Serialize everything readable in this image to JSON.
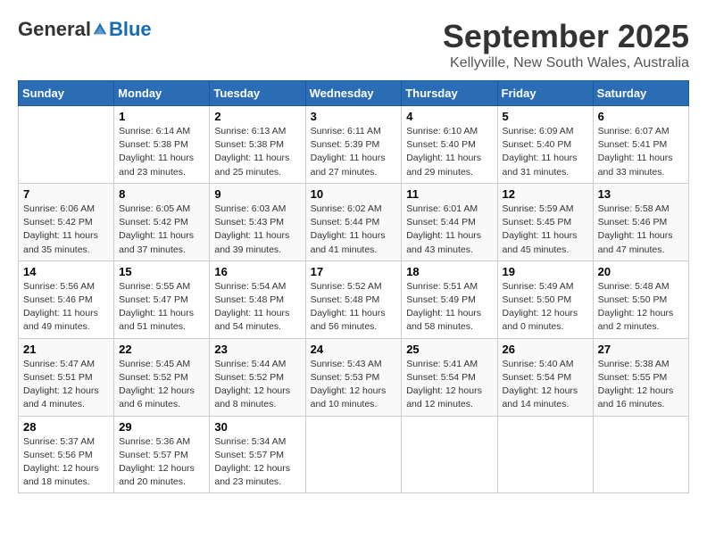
{
  "header": {
    "logo_general": "General",
    "logo_blue": "Blue",
    "month_title": "September 2025",
    "location": "Kellyville, New South Wales, Australia"
  },
  "days_of_week": [
    "Sunday",
    "Monday",
    "Tuesday",
    "Wednesday",
    "Thursday",
    "Friday",
    "Saturday"
  ],
  "weeks": [
    [
      {
        "day": "",
        "info": ""
      },
      {
        "day": "1",
        "info": "Sunrise: 6:14 AM\nSunset: 5:38 PM\nDaylight: 11 hours\nand 23 minutes."
      },
      {
        "day": "2",
        "info": "Sunrise: 6:13 AM\nSunset: 5:38 PM\nDaylight: 11 hours\nand 25 minutes."
      },
      {
        "day": "3",
        "info": "Sunrise: 6:11 AM\nSunset: 5:39 PM\nDaylight: 11 hours\nand 27 minutes."
      },
      {
        "day": "4",
        "info": "Sunrise: 6:10 AM\nSunset: 5:40 PM\nDaylight: 11 hours\nand 29 minutes."
      },
      {
        "day": "5",
        "info": "Sunrise: 6:09 AM\nSunset: 5:40 PM\nDaylight: 11 hours\nand 31 minutes."
      },
      {
        "day": "6",
        "info": "Sunrise: 6:07 AM\nSunset: 5:41 PM\nDaylight: 11 hours\nand 33 minutes."
      }
    ],
    [
      {
        "day": "7",
        "info": "Sunrise: 6:06 AM\nSunset: 5:42 PM\nDaylight: 11 hours\nand 35 minutes."
      },
      {
        "day": "8",
        "info": "Sunrise: 6:05 AM\nSunset: 5:42 PM\nDaylight: 11 hours\nand 37 minutes."
      },
      {
        "day": "9",
        "info": "Sunrise: 6:03 AM\nSunset: 5:43 PM\nDaylight: 11 hours\nand 39 minutes."
      },
      {
        "day": "10",
        "info": "Sunrise: 6:02 AM\nSunset: 5:44 PM\nDaylight: 11 hours\nand 41 minutes."
      },
      {
        "day": "11",
        "info": "Sunrise: 6:01 AM\nSunset: 5:44 PM\nDaylight: 11 hours\nand 43 minutes."
      },
      {
        "day": "12",
        "info": "Sunrise: 5:59 AM\nSunset: 5:45 PM\nDaylight: 11 hours\nand 45 minutes."
      },
      {
        "day": "13",
        "info": "Sunrise: 5:58 AM\nSunset: 5:46 PM\nDaylight: 11 hours\nand 47 minutes."
      }
    ],
    [
      {
        "day": "14",
        "info": "Sunrise: 5:56 AM\nSunset: 5:46 PM\nDaylight: 11 hours\nand 49 minutes."
      },
      {
        "day": "15",
        "info": "Sunrise: 5:55 AM\nSunset: 5:47 PM\nDaylight: 11 hours\nand 51 minutes."
      },
      {
        "day": "16",
        "info": "Sunrise: 5:54 AM\nSunset: 5:48 PM\nDaylight: 11 hours\nand 54 minutes."
      },
      {
        "day": "17",
        "info": "Sunrise: 5:52 AM\nSunset: 5:48 PM\nDaylight: 11 hours\nand 56 minutes."
      },
      {
        "day": "18",
        "info": "Sunrise: 5:51 AM\nSunset: 5:49 PM\nDaylight: 11 hours\nand 58 minutes."
      },
      {
        "day": "19",
        "info": "Sunrise: 5:49 AM\nSunset: 5:50 PM\nDaylight: 12 hours\nand 0 minutes."
      },
      {
        "day": "20",
        "info": "Sunrise: 5:48 AM\nSunset: 5:50 PM\nDaylight: 12 hours\nand 2 minutes."
      }
    ],
    [
      {
        "day": "21",
        "info": "Sunrise: 5:47 AM\nSunset: 5:51 PM\nDaylight: 12 hours\nand 4 minutes."
      },
      {
        "day": "22",
        "info": "Sunrise: 5:45 AM\nSunset: 5:52 PM\nDaylight: 12 hours\nand 6 minutes."
      },
      {
        "day": "23",
        "info": "Sunrise: 5:44 AM\nSunset: 5:52 PM\nDaylight: 12 hours\nand 8 minutes."
      },
      {
        "day": "24",
        "info": "Sunrise: 5:43 AM\nSunset: 5:53 PM\nDaylight: 12 hours\nand 10 minutes."
      },
      {
        "day": "25",
        "info": "Sunrise: 5:41 AM\nSunset: 5:54 PM\nDaylight: 12 hours\nand 12 minutes."
      },
      {
        "day": "26",
        "info": "Sunrise: 5:40 AM\nSunset: 5:54 PM\nDaylight: 12 hours\nand 14 minutes."
      },
      {
        "day": "27",
        "info": "Sunrise: 5:38 AM\nSunset: 5:55 PM\nDaylight: 12 hours\nand 16 minutes."
      }
    ],
    [
      {
        "day": "28",
        "info": "Sunrise: 5:37 AM\nSunset: 5:56 PM\nDaylight: 12 hours\nand 18 minutes."
      },
      {
        "day": "29",
        "info": "Sunrise: 5:36 AM\nSunset: 5:57 PM\nDaylight: 12 hours\nand 20 minutes."
      },
      {
        "day": "30",
        "info": "Sunrise: 5:34 AM\nSunset: 5:57 PM\nDaylight: 12 hours\nand 23 minutes."
      },
      {
        "day": "",
        "info": ""
      },
      {
        "day": "",
        "info": ""
      },
      {
        "day": "",
        "info": ""
      },
      {
        "day": "",
        "info": ""
      }
    ]
  ]
}
